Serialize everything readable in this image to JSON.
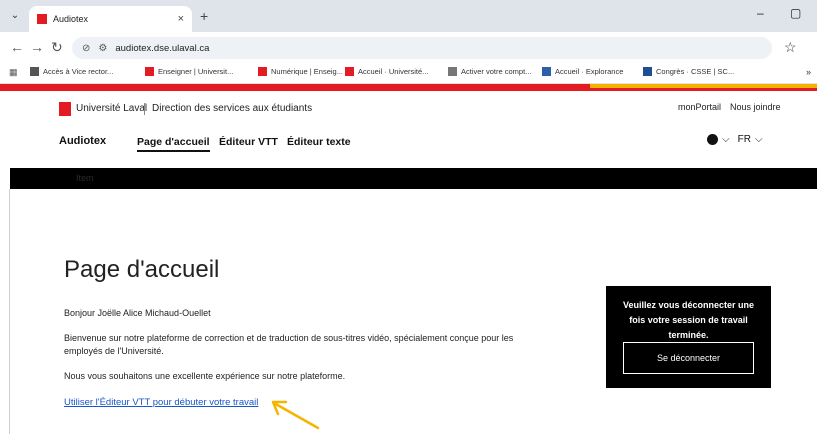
{
  "browser": {
    "tab_title": "Audiotex",
    "tab_close": "×",
    "new_tab": "+",
    "url": "audiotex.dse.ulaval.ca",
    "window_minimize": "–",
    "window_maximize": "▢",
    "bookmarks": [
      {
        "label": "Accès à Vice rector...",
        "color": "#555555"
      },
      {
        "label": "Enseigner | Universit...",
        "color": "#e31b23"
      },
      {
        "label": "Numérique | Enseig...",
        "color": "#e31b23"
      },
      {
        "label": "Accueil · Université...",
        "color": "#e31b23"
      },
      {
        "label": "Activer votre compt...",
        "color": "#777777"
      },
      {
        "label": "Accueil · Explorance",
        "color": "#2b5fa8"
      },
      {
        "label": "Congrès · CSSE | SC...",
        "color": "#1d4f91"
      }
    ],
    "bookmarks_more": "»"
  },
  "site": {
    "university": "Université Laval",
    "department": "Direction des services aux étudiants",
    "util_links": [
      "monPortail",
      "Nous joindre"
    ],
    "brand": "Audiotex",
    "nav": [
      "Page d'accueil",
      "Éditeur VTT",
      "Éditeur texte"
    ],
    "language": "FR",
    "subnav_item": "Item"
  },
  "main": {
    "title": "Page d'accueil",
    "greeting": "Bonjour Joëlle Alice Michaud-Ouellet",
    "welcome_line1": "Bienvenue sur notre plateforme de correction et de traduction de sous-titres vidéo, spécialement conçue pour les",
    "welcome_line2": "employés de l'Université.",
    "wish": "Nous vous souhaitons une excellente expérience sur notre plateforme.",
    "cta_link": "Utiliser l'Éditeur VTT pour débuter votre travail"
  },
  "logout": {
    "message": "Veuillez vous déconnecter une fois votre session de travail terminée.",
    "button": "Se déconnecter"
  },
  "colors": {
    "brand_red": "#e31b23",
    "brand_gold": "#f0b400",
    "link_blue": "#1a56c9",
    "annotation_arrow": "#f5b400"
  }
}
